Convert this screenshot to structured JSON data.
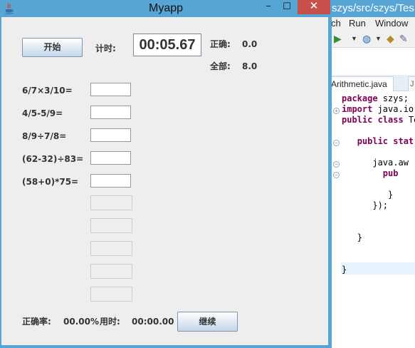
{
  "eclipse": {
    "title": "szys/src/szys/Tes",
    "menu": [
      "ch",
      "Run",
      "Window"
    ],
    "editor_tab": "Arithmetic.java",
    "code": [
      {
        "kw": "package",
        "rest": " szys;"
      },
      {
        "kw": "import",
        "rest": " java.io."
      },
      {
        "kw": "public class",
        "rest": " Te"
      },
      {
        "kw": "",
        "rest": ""
      },
      {
        "kw": "public stat",
        "rest": "",
        "indent": "   "
      },
      {
        "kw": "",
        "rest": ""
      },
      {
        "kw": "",
        "rest": "java.aw",
        "indent": "      "
      },
      {
        "kw": "pub",
        "rest": "",
        "indent": "        "
      },
      {
        "kw": "",
        "rest": ""
      },
      {
        "kw": "",
        "rest": "}",
        "indent": "         "
      },
      {
        "kw": "",
        "rest": "});",
        "indent": "      "
      },
      {
        "kw": "",
        "rest": ""
      },
      {
        "kw": "",
        "rest": ""
      },
      {
        "kw": "",
        "rest": "}",
        "indent": "   "
      },
      {
        "kw": "",
        "rest": ""
      },
      {
        "kw": "",
        "rest": ""
      },
      {
        "kw": "",
        "rest": "}"
      }
    ]
  },
  "app": {
    "title": "Myapp",
    "close_glyph": "✕",
    "min_glyph": "−",
    "max_glyph": "☐",
    "start_button": "开始",
    "timer_label": "计时:",
    "timer_value": "00:05.67",
    "correct_label": "正确:",
    "correct_value": "0.0",
    "total_label": "全部:",
    "total_value": "8.0",
    "questions": [
      "6/7×3/10=",
      "4/5-5/9=",
      "8/9÷7/8=",
      "(62-32)÷83=",
      "(58+0)*75="
    ],
    "accuracy_label": "正确率:",
    "accuracy_value": "00.00%",
    "time_used_label": "用时:",
    "time_used_value": "00:00.00",
    "continue_button": "继续"
  }
}
